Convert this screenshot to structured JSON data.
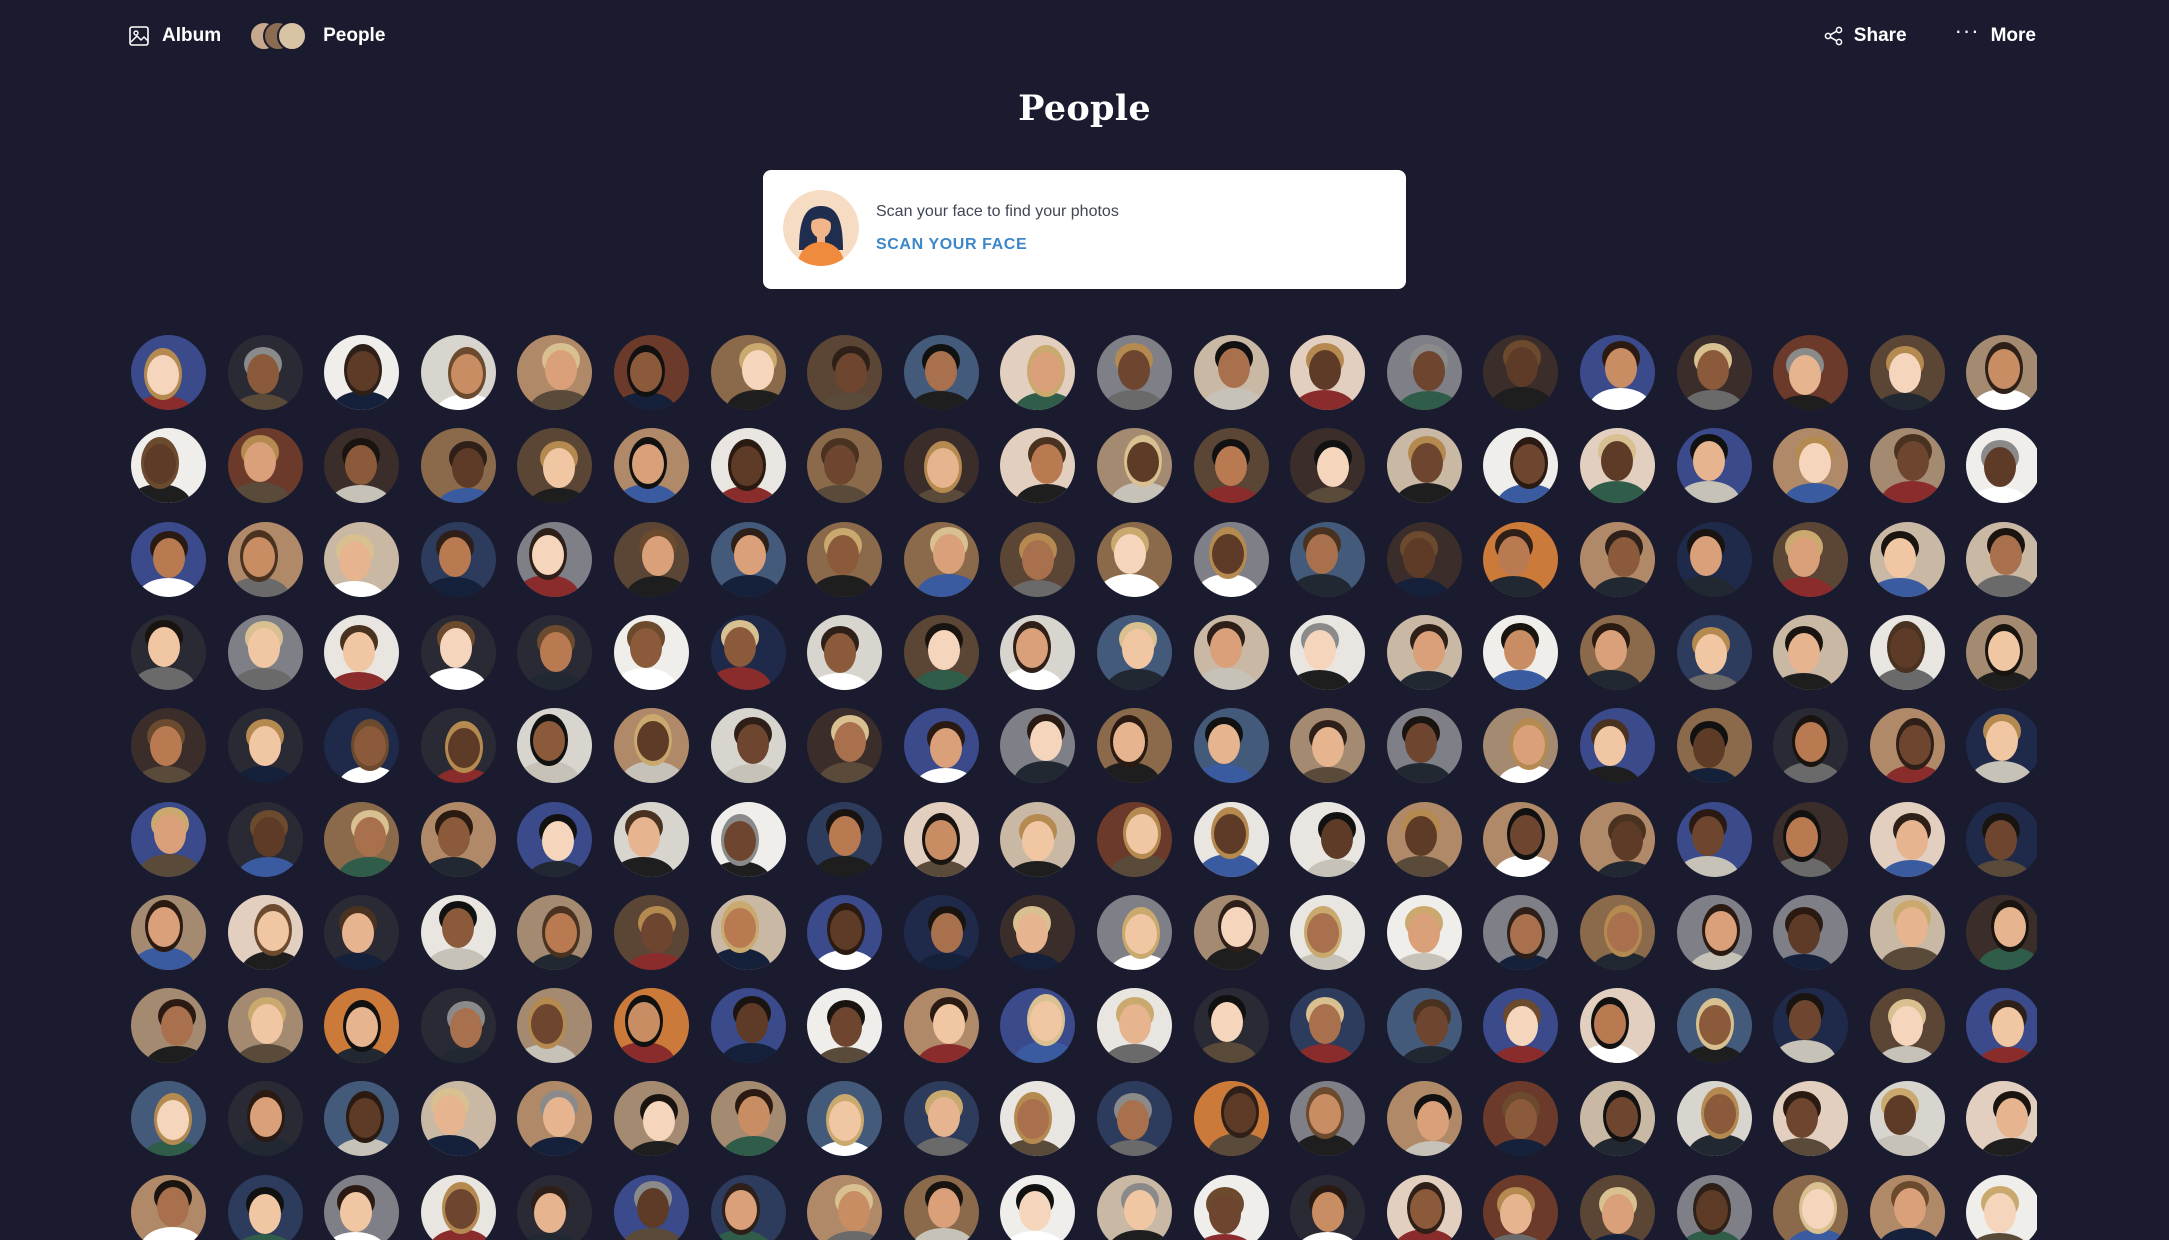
{
  "nav": {
    "album_label": "Album",
    "people_label": "People",
    "share_label": "Share",
    "more_label": "More",
    "icons": [
      "image-icon",
      "share-icon",
      "more-dots-icon"
    ]
  },
  "page": {
    "title": "People"
  },
  "scan_card": {
    "text": "Scan your face to find your photos",
    "link": "SCAN YOUR FACE",
    "accent": "#3d87c9"
  },
  "people_grid": {
    "columns": 20,
    "visible_rows": 10,
    "face_count": 200
  },
  "colors": {
    "background": "#1b1b2f",
    "card": "#ffffff",
    "text": "#ffffff"
  }
}
